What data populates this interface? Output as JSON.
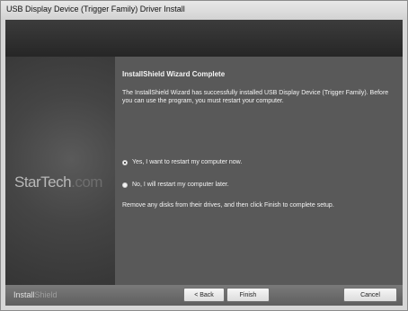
{
  "window": {
    "title": "USB Display Device (Trigger Family) Driver Install"
  },
  "sidebar": {
    "logo_primary": "StarTech",
    "logo_suffix": ".com"
  },
  "main": {
    "heading": "InstallShield Wizard Complete",
    "description": "The InstallShield Wizard has successfully installed USB Display Device (Trigger Family).  Before you can use the program, you must restart your computer.",
    "options": [
      {
        "label": "Yes, I want to restart my computer now.",
        "selected": true
      },
      {
        "label": "No, I will restart my computer later.",
        "selected": false
      }
    ],
    "instruction": "Remove any disks from their drives, and then click Finish to complete setup."
  },
  "footer": {
    "brand_primary": "Install",
    "brand_secondary": "Shield",
    "back_label": "< Back",
    "finish_label": "Finish",
    "cancel_label": "Cancel"
  },
  "colors": {
    "header": "#2e2e2e",
    "content_bg": "#595959",
    "footer": "#6a6a6a"
  }
}
